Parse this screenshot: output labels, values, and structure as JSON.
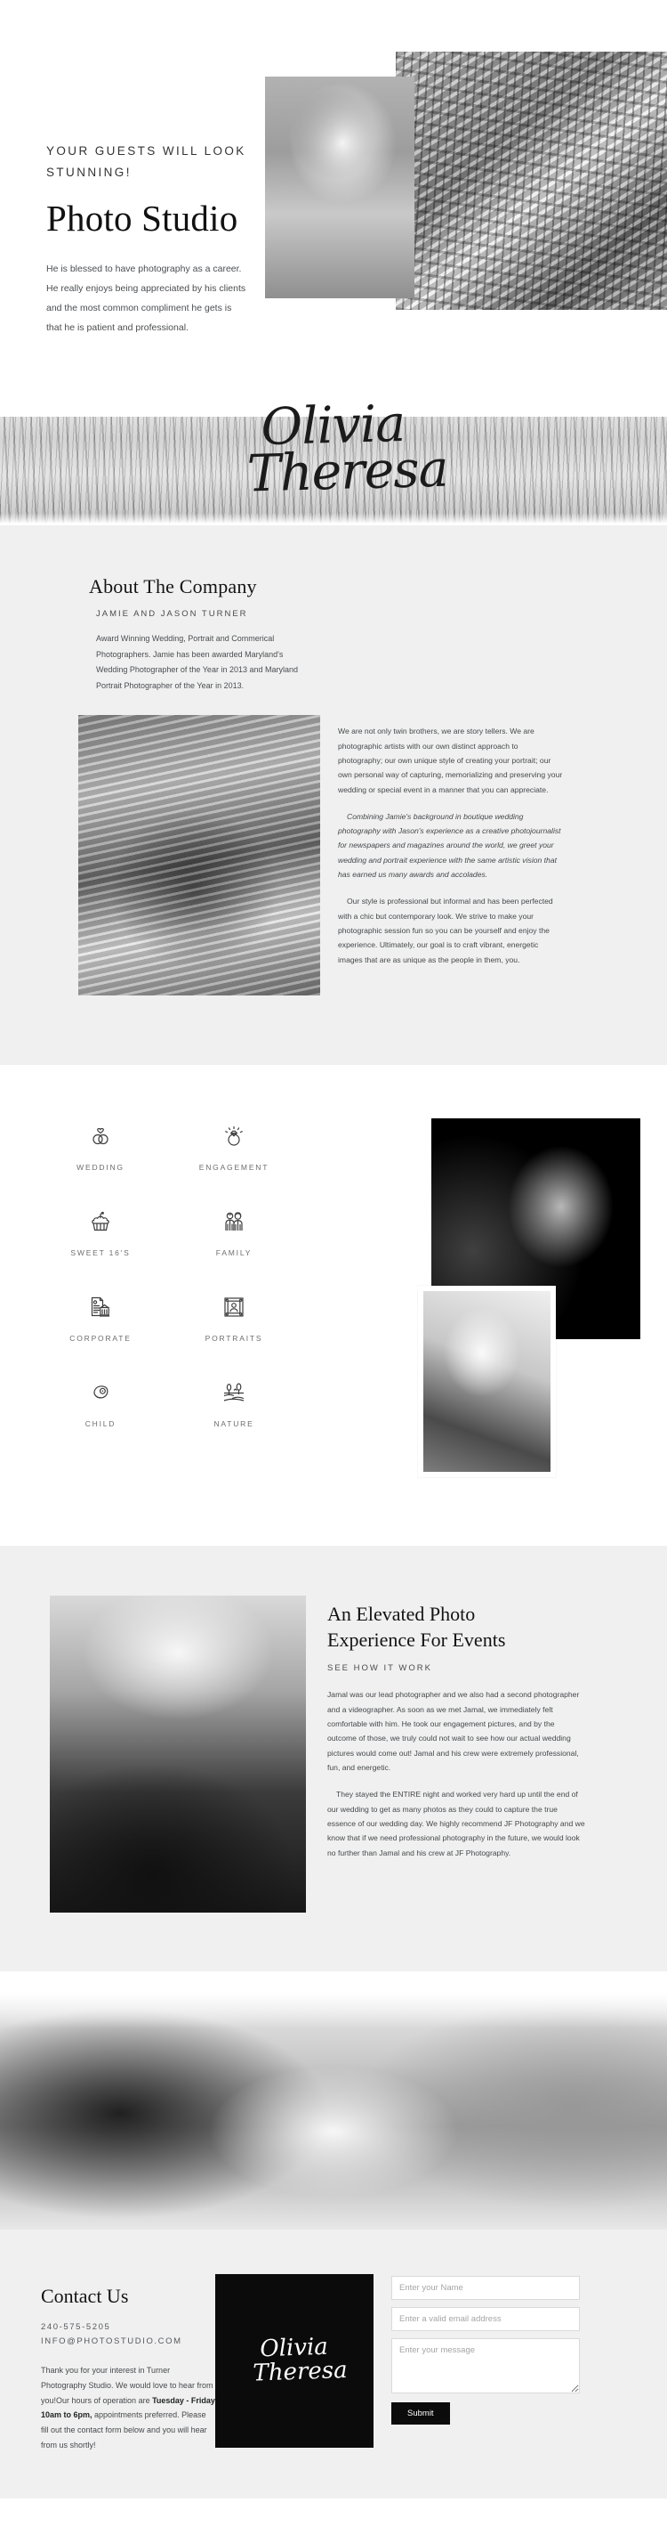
{
  "hero": {
    "kicker": "YOUR GUESTS WILL LOOK STUNNING!",
    "title": "Photo Studio",
    "paragraph": "He is blessed to have photography as a career. He really enjoys being appreciated by his clients and the most common compliment he gets is that he is patient and professional.",
    "image_back_alt": "textured-wall-photo",
    "image_front_alt": "bride-portrait-photo"
  },
  "name_banner": {
    "line1": "Olivia",
    "line2": "Theresa",
    "background_alt": "wood-texture-banner"
  },
  "about": {
    "title": "About The Company",
    "subtitle": "JAMIE AND JASON TURNER",
    "lead": "Award Winning Wedding, Portrait and Commerical Photographers. Jamie has been awarded Maryland's Wedding Photographer of the Year in 2013 and Maryland Portrait Photographer of the Year in 2013.",
    "photo_alt": "underwater-legs-photo",
    "paragraphs": [
      {
        "italic": false,
        "indent": false,
        "text": "We are not only twin brothers, we are story tellers. We are photographic artists with our own distinct approach to photography; our own unique style of creating your portrait; our own personal way of capturing, memorializing and preserving your wedding or special event in a manner that you can appreciate."
      },
      {
        "italic": true,
        "indent": true,
        "text": "Combining Jamie's background in boutique wedding photography with Jason's experience as a creative photojournalist for newspapers and magazines around the world, we greet your wedding and portrait experience with the same artistic vision that has earned us many awards and accolades."
      },
      {
        "italic": false,
        "indent": true,
        "text": "Our style is professional but informal and has been perfected with a chic but contemporary look. We strive to make your photographic session fun so you can be yourself and enjoy the experience. Ultimately, our goal is to craft vibrant, energetic images that are as unique as the people in them, you."
      }
    ]
  },
  "services": {
    "items": [
      {
        "icon": "wedding-rings-icon",
        "label": "WEDDING"
      },
      {
        "icon": "engagement-ring-icon",
        "label": "ENGAGEMENT"
      },
      {
        "icon": "cupcake-icon",
        "label": "SWEET 16'S"
      },
      {
        "icon": "family-couple-icon",
        "label": "FAMILY"
      },
      {
        "icon": "corporate-building-icon",
        "label": "CORPORATE"
      },
      {
        "icon": "framed-portrait-icon",
        "label": "PORTRAITS"
      },
      {
        "icon": "baby-icon",
        "label": "CHILD"
      },
      {
        "icon": "landscape-field-icon",
        "label": "NATURE"
      }
    ],
    "image_dark_alt": "woman-profile-dark-photo",
    "image_light_alt": "woman-beanie-photo"
  },
  "events": {
    "title_line1": "An Elevated Photo",
    "title_line2": "Experience For Events",
    "subtitle": "SEE HOW IT WORK",
    "photo_alt": "bird-sky-clouds-photo",
    "paragraphs": [
      {
        "indent": false,
        "text": "Jamal was our lead photographer and we also had a second photographer and a videographer. As soon as we met Jamal, we immediately felt comfortable with him. He took our engagement pictures, and by the outcome of those, we truly could not wait to see how our actual wedding pictures would come out! Jamal and his crew were extremely professional, fun, and energetic."
      },
      {
        "indent": true,
        "text": "They stayed the ENTIRE night and worked very hard up until the end of our wedding to get as many photos as they could to capture the true essence of our wedding day. We highly recommend JF Photography and we know that if we need professional photography in the future, we would look no further than Jamal and his crew at JF Photography."
      }
    ]
  },
  "handshake": {
    "alt": "handshake-photo"
  },
  "contact": {
    "title": "Contact Us",
    "phone": "240-575-5205",
    "email": "INFO@PHOTOSTUDIO.COM",
    "note_before": "Thank you for your interest in Turner Photography Studio. We would love to hear from you!Our hours of operation are ",
    "note_bold": "Tuesday - Friday 10am to 6pm,",
    "note_after": " appointments preferred. Please fill out the contact form below and you will hear from us shortly!",
    "card_line1": "Olivia",
    "card_line2": "Theresa",
    "form": {
      "name_placeholder": "Enter your Name",
      "name_value": "",
      "email_placeholder": "Enter a valid email address",
      "email_value": "",
      "message_placeholder": "Enter your message",
      "message_value": "",
      "submit_label": "Submit"
    }
  },
  "colors": {
    "page_bg": "#ffffff",
    "section_bg": "#f0f0f0",
    "ink": "#131313",
    "body_text": "#45484b",
    "muted": "#6d6d6d",
    "button_bg": "#0b0b0b"
  }
}
